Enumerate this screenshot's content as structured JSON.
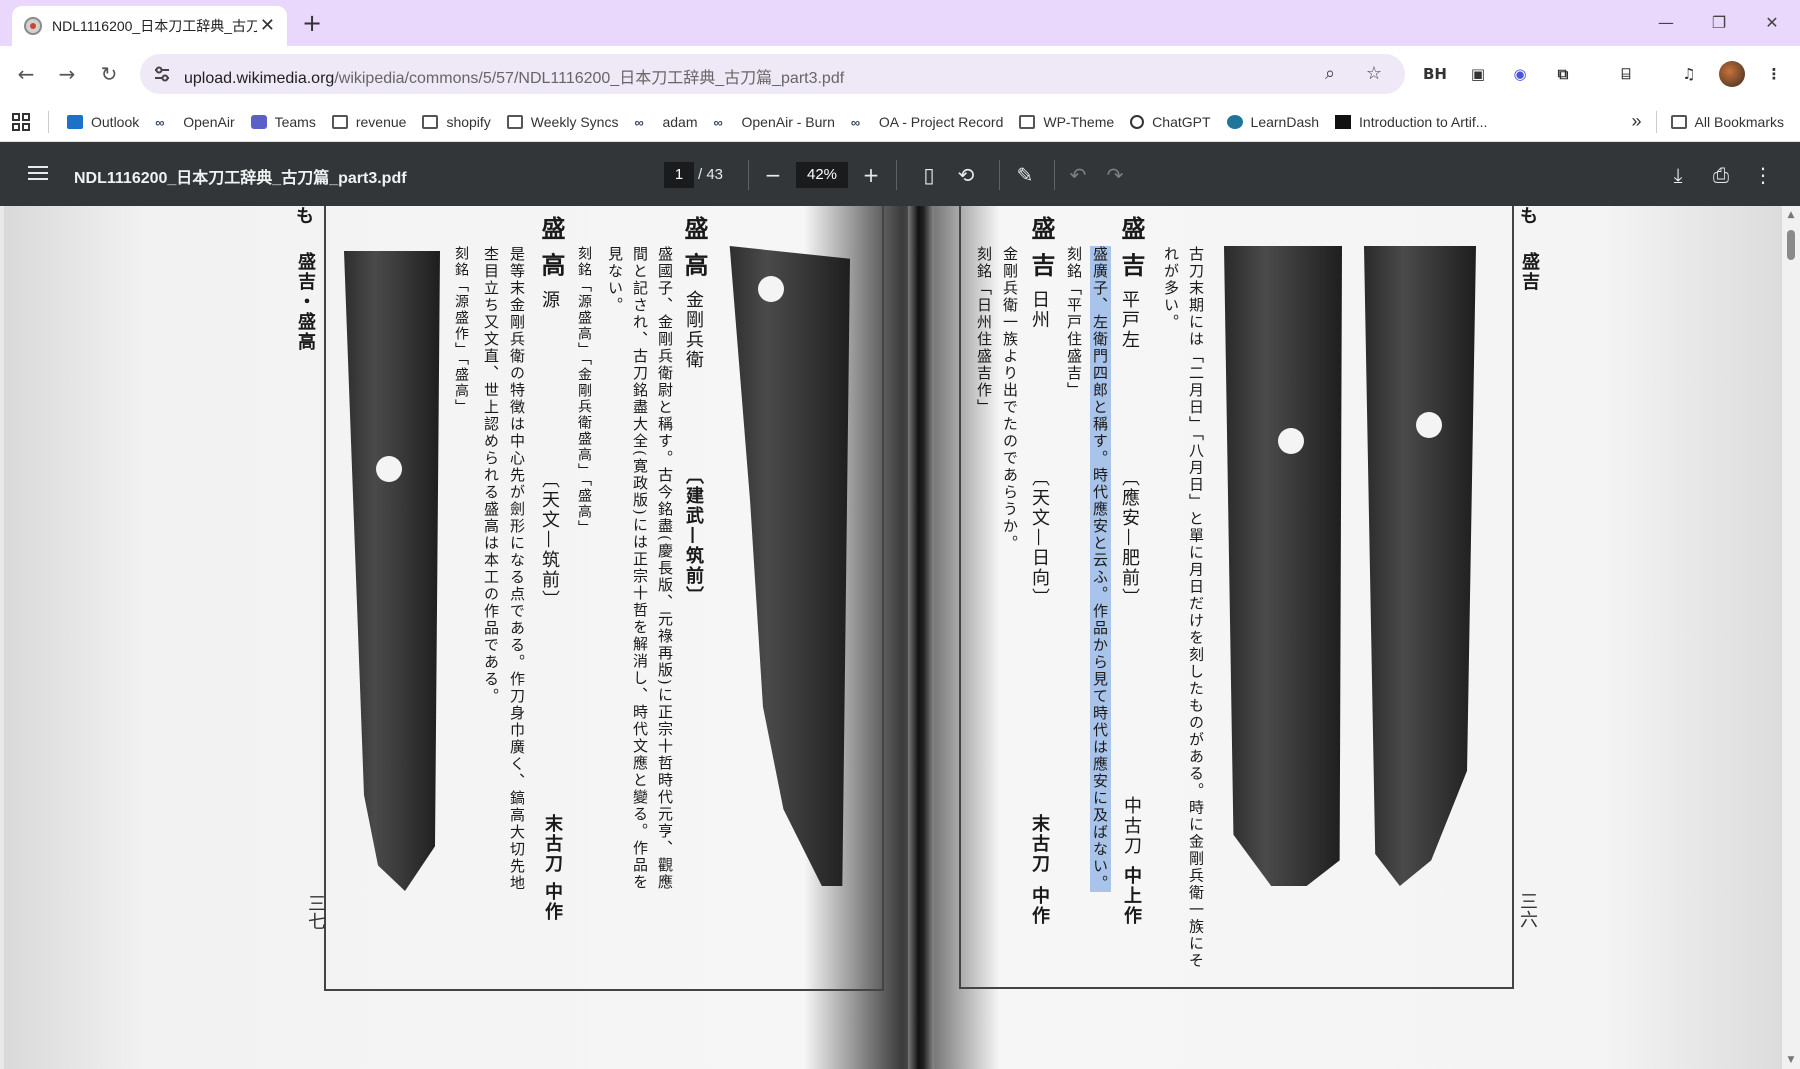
{
  "browser": {
    "tab": {
      "title": "NDL1116200_日本刀工辞典_古刀篇_part3.pdf",
      "close": "✕"
    },
    "new_tab": "+",
    "window_controls": {
      "minimize": "—",
      "restore": "❐",
      "close": "✕"
    },
    "nav": {
      "back": "←",
      "forward": "→",
      "reload": "↻"
    },
    "url": {
      "host": "upload.wikimedia.org",
      "path": "/wikipedia/commons/5/57/NDL1116200_日本刀工辞典_古刀篇_part3.pdf"
    },
    "omnibox_icons": [
      "zoom-icon",
      "bookmark-star-icon"
    ],
    "extensions": [
      "BH",
      "extension-icon",
      "extension-circle-icon",
      "puzzle-icon",
      "tab-search-icon",
      "media-icon"
    ]
  },
  "bookmarks": [
    {
      "label": "Outlook",
      "icon": "outlook-icon"
    },
    {
      "label": "OpenAir",
      "icon": "openair-icon"
    },
    {
      "label": "Teams",
      "icon": "teams-icon"
    },
    {
      "label": "revenue",
      "icon": "folder-icon"
    },
    {
      "label": "shopify",
      "icon": "folder-icon"
    },
    {
      "label": "Weekly Syncs",
      "icon": "folder-icon"
    },
    {
      "label": "adam",
      "icon": "openair-icon"
    },
    {
      "label": "OpenAir - Burn",
      "icon": "openair-icon"
    },
    {
      "label": "OA - Project Record",
      "icon": "openair-icon"
    },
    {
      "label": "WP-Theme",
      "icon": "folder-icon"
    },
    {
      "label": "ChatGPT",
      "icon": "chatgpt-icon"
    },
    {
      "label": "LearnDash",
      "icon": "wordpress-icon"
    },
    {
      "label": "Introduction to Artif...",
      "icon": "site-icon"
    }
  ],
  "bookmarks_overflow": "»",
  "all_bookmarks": "All Bookmarks",
  "pdf": {
    "title": "NDL1116200_日本刀工辞典_古刀篇_part3.pdf",
    "page_current": "1",
    "page_total": "/ 43",
    "zoom": "42%",
    "buttons": {
      "zoom_out": "−",
      "zoom_in": "+",
      "fit": "▯",
      "rotate": "⟲",
      "annotate": "✎",
      "undo": "↶",
      "redo": "↷",
      "download": "⤓",
      "print": "⎙",
      "more": "⋮"
    }
  },
  "scan": {
    "left_page": {
      "header_mark": "も",
      "header_title": "盛吉・盛高",
      "page_number": "三七",
      "entry1": {
        "name": "盛 高",
        "school": "金剛兵衛",
        "period": "〔建武—筑前〕",
        "body1": "盛國子、金剛兵衛尉と稱す。古今銘盡(慶長版、元祿再版)に正宗十哲時代元亨、觀應",
        "body2": "間と記され、古刀銘盡大全(寛政版)には正宗十哲を解消し、時代文應と變る。作品を",
        "body3": "見ない。",
        "inscription": "刻銘「源盛高」「金剛兵衛盛高」「盛高」"
      },
      "entry2": {
        "name": "盛 高",
        "school": "源",
        "period": "〔天文—筑前〕",
        "grade": "末古刀",
        "rank": "中作",
        "body1": "是等末金剛兵衛の特徴は中心先が劍形になる点である。作刀身巾廣く、鎬高大切先地",
        "body2": "杢目立ち又文直、世上認められる盛高は本工の作品である。",
        "inscription": "刻銘「源盛作」「盛高」"
      }
    },
    "right_page": {
      "header_mark": "も",
      "header_title": "盛吉",
      "page_number": "三六",
      "intro1": "古刀末期には「二月日」「八月日」と單に月日だけを刻したものがある。時に金剛兵衛一族にそ",
      "intro2": "れが多い。",
      "entry1": {
        "name": "盛 吉",
        "school": "平戸左",
        "period": "〔應安—肥前〕",
        "grade": "中古刀",
        "rank": "中上作",
        "body_highlighted": "盛廣子、左衛門四郎と稱す。時代應安と云ふ。作品から見て時代は應安に及ばない。",
        "inscription": "刻銘「平戸住盛吉」"
      },
      "entry2": {
        "name": "盛 吉",
        "school": "日州",
        "period": "〔天文—日向〕",
        "grade": "末古刀",
        "rank": "中作",
        "body1": "金剛兵衛一族より出でたのであらうか。",
        "inscription": "刻銘「日州住盛吉作」"
      }
    }
  }
}
